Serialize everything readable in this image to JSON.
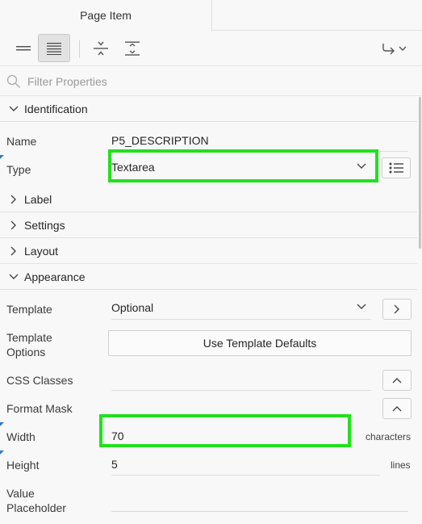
{
  "tabs": {
    "active_label": "Page Item"
  },
  "toolbar": {
    "icons": [
      "collapse-all-icon",
      "expand-all-icon",
      "show-common-icon",
      "show-all-icon",
      "go-to-group-icon"
    ]
  },
  "filter": {
    "placeholder": "Filter Properties"
  },
  "groups": {
    "identification": "Identification",
    "label": "Label",
    "settings": "Settings",
    "layout": "Layout",
    "appearance": "Appearance"
  },
  "properties": {
    "name": {
      "label": "Name",
      "value": "P5_DESCRIPTION"
    },
    "type": {
      "label": "Type",
      "value": "Textarea"
    },
    "template": {
      "label": "Template",
      "value": "Optional"
    },
    "template_options": {
      "label_line1": "Template",
      "label_line2": "Options",
      "button": "Use Template Defaults"
    },
    "css_classes": {
      "label": "CSS Classes",
      "value": ""
    },
    "format_mask": {
      "label": "Format Mask",
      "value": ""
    },
    "width": {
      "label": "Width",
      "value": "70",
      "unit": "characters"
    },
    "height": {
      "label": "Height",
      "value": "5",
      "unit": "lines"
    },
    "value_placeholder": {
      "label_line1": "Value",
      "label_line2": "Placeholder",
      "value": ""
    }
  },
  "colors": {
    "highlight": "#22e01e",
    "required_marker": "#2d7bc6"
  }
}
